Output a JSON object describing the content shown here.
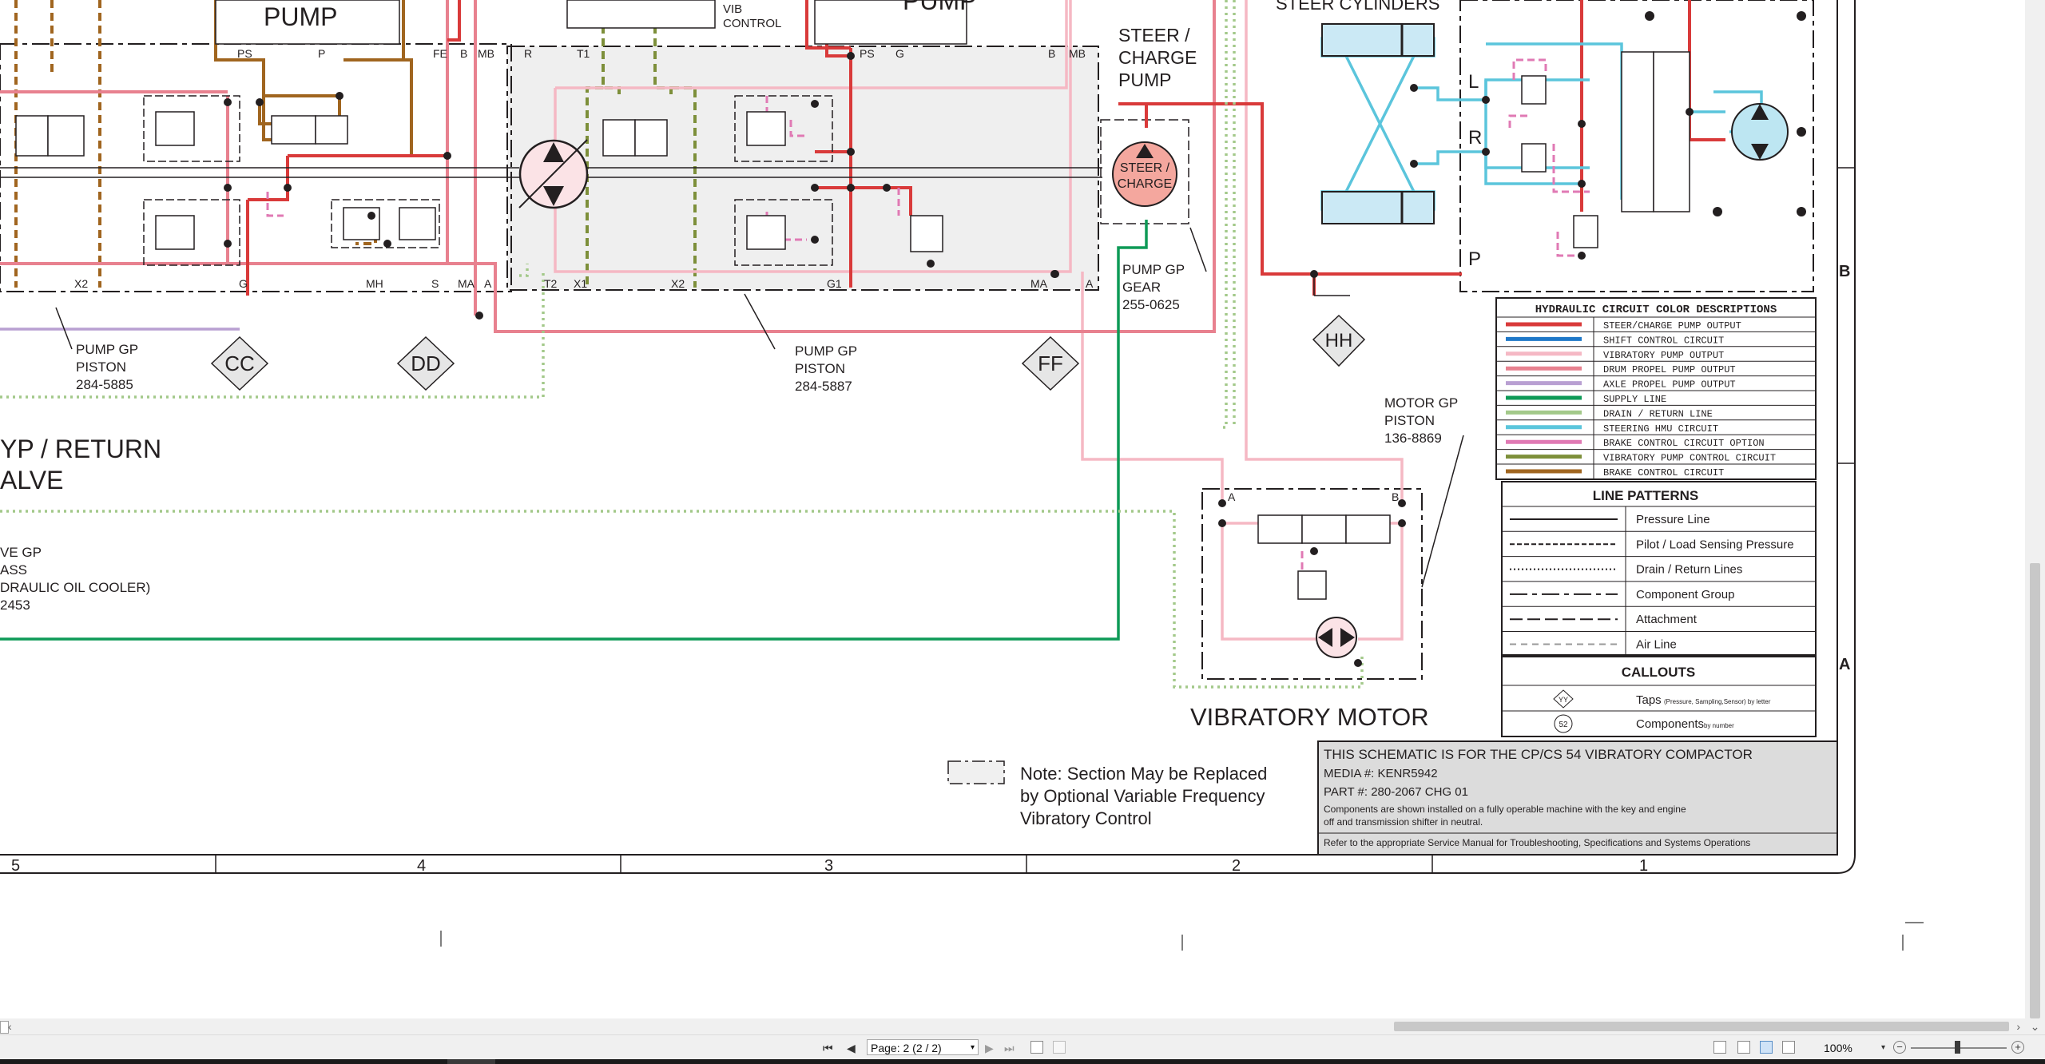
{
  "schematic": {
    "colors": {
      "steer_charge": "#d93a3a",
      "shift": "#1f78c8",
      "vibratory_pump": "#f5b8c4",
      "drum_propel": "#e8818f",
      "axle_propel": "#b9a0d2",
      "supply": "#0e9a57",
      "drain": "#a3c98a",
      "steering_hmu": "#5bc5dc",
      "brake_option": "#e07ab4",
      "vib_control": "#7d8f3a",
      "brake_control": "#a0651f"
    },
    "titles": {
      "pump_left": "PUMP",
      "pump_right": "PUMP",
      "vib_control_1": "VIB",
      "vib_control_2": "CONTROL",
      "steer_cylinders": "STEER CYLINDERS",
      "steer_charge_1": "STEER /",
      "steer_charge_2": "CHARGE",
      "steer_charge_3": "PUMP",
      "steer_charge_sym_1": "STEER /",
      "steer_charge_sym_2": "CHARGE",
      "bypass_1": "YP / RETURN",
      "bypass_2": "ALVE",
      "valve_gp_1": "VE GP",
      "valve_gp_2": "ASS",
      "valve_gp_3": "DRAULIC OIL COOLER)",
      "valve_gp_4": "2453",
      "vibratory_motor": "VIBRATORY MOTOR"
    },
    "parts": {
      "pump_gp_piston_1_a": "PUMP GP",
      "pump_gp_piston_1_b": "PISTON",
      "pump_gp_piston_1_c": "284-5885",
      "pump_gp_piston_2_a": "PUMP GP",
      "pump_gp_piston_2_b": "PISTON",
      "pump_gp_piston_2_c": "284-5887",
      "pump_gp_gear_a": "PUMP GP",
      "pump_gp_gear_b": "GEAR",
      "pump_gp_gear_c": "255-0625",
      "motor_gp_piston_a": "MOTOR GP",
      "motor_gp_piston_b": "PISTON",
      "motor_gp_piston_c": "136-8869"
    },
    "ports": {
      "ps1": "PS",
      "p1": "P",
      "fe": "FE",
      "b1": "B",
      "mb1": "MB",
      "r": "R",
      "t1": "T1",
      "ps2": "PS",
      "g1": "G",
      "b2": "B",
      "mb2": "MB",
      "x2a": "X2",
      "g2": "G",
      "mh": "MH",
      "s": "S",
      "ma1": "MA",
      "a1": "A",
      "t2": "T2",
      "x1": "X1",
      "x2b": "X2",
      "g1b": "G1",
      "ma2": "MA",
      "a2": "A",
      "l": "L",
      "rr": "R",
      "pp": "P",
      "motor_a": "A",
      "motor_b": "B"
    },
    "taps": [
      "CC",
      "DD",
      "FF",
      "HH"
    ],
    "legend": {
      "title": "HYDRAULIC CIRCUIT COLOR DESCRIPTIONS",
      "items": [
        {
          "label": "STEER/CHARGE PUMP OUTPUT",
          "color": "#d93a3a"
        },
        {
          "label": "SHIFT CONTROL CIRCUIT",
          "color": "#1f78c8"
        },
        {
          "label": "VIBRATORY PUMP OUTPUT",
          "color": "#f5b8c4"
        },
        {
          "label": "DRUM PROPEL PUMP OUTPUT",
          "color": "#e8818f"
        },
        {
          "label": "AXLE PROPEL PUMP OUTPUT",
          "color": "#b9a0d2"
        },
        {
          "label": "SUPPLY LINE",
          "color": "#0e9a57"
        },
        {
          "label": "DRAIN / RETURN LINE",
          "color": "#a3c98a"
        },
        {
          "label": "STEERING HMU CIRCUIT",
          "color": "#5bc5dc"
        },
        {
          "label": "BRAKE CONTROL CIRCUIT OPTION",
          "color": "#e07ab4"
        },
        {
          "label": "VIBRATORY PUMP CONTROL CIRCUIT",
          "color": "#7d8f3a"
        },
        {
          "label": "BRAKE CONTROL CIRCUIT",
          "color": "#a0651f"
        }
      ]
    },
    "line_patterns": {
      "title": "LINE PATTERNS",
      "items": [
        "Pressure Line",
        "Pilot / Load Sensing Pressure",
        "Drain / Return Lines",
        "Component Group",
        "Attachment",
        "Air Line"
      ]
    },
    "callouts": {
      "title": "CALLOUTS",
      "tap_symbol": "YY",
      "tap_label": "Taps",
      "tap_note": "(Pressure, Sampling,Sensor) by letter",
      "comp_symbol": "52",
      "comp_label": "Components",
      "comp_note": "by number"
    },
    "note": {
      "line1": "Note: Section May be Replaced",
      "line2": "by Optional Variable Frequency",
      "line3": "Vibratory Control"
    },
    "title_block": {
      "line1": "THIS SCHEMATIC IS FOR THE CP/CS 54 VIBRATORY COMPACTOR",
      "line2": "MEDIA #: KENR5942",
      "line3": "PART #: 280-2067 CHG 01",
      "line4": "Components are shown installed on a fully operable machine with the key and engine",
      "line5": "off and transmission shifter in neutral.",
      "line6": "Refer to the appropriate Service Manual for Troubleshooting, Specifications and Systems Operations"
    },
    "zones_x": [
      "5",
      "4",
      "3",
      "2",
      "1"
    ],
    "zones_y": [
      "B",
      "A"
    ]
  },
  "viewer": {
    "page_label": "Page: 2 (2 / 2)",
    "zoom": "100%"
  }
}
